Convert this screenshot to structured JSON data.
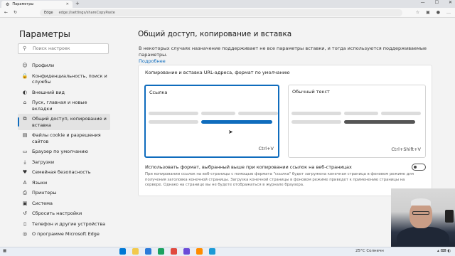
{
  "browser": {
    "tab_title": "Параметры",
    "address_prefix": "Edge",
    "address_url": "edge://settings/shareCopyPaste"
  },
  "sidebar": {
    "title": "Параметры",
    "search_placeholder": "Поиск настроек",
    "items": [
      {
        "label": "Профили",
        "icon": "person-icon"
      },
      {
        "label": "Конфиденциальность, поиск и службы",
        "icon": "lock-icon"
      },
      {
        "label": "Внешний вид",
        "icon": "appearance-icon"
      },
      {
        "label": "Пуск, главная и новые вкладки",
        "icon": "home-icon"
      },
      {
        "label": "Общий доступ, копирование и вставка",
        "icon": "share-icon",
        "active": true
      },
      {
        "label": "Файлы cookie и разрешения сайтов",
        "icon": "cookie-icon"
      },
      {
        "label": "Браузер по умолчанию",
        "icon": "browser-icon"
      },
      {
        "label": "Загрузки",
        "icon": "download-icon"
      },
      {
        "label": "Семейная безопасность",
        "icon": "family-icon"
      },
      {
        "label": "Языки",
        "icon": "language-icon"
      },
      {
        "label": "Принтеры",
        "icon": "printer-icon"
      },
      {
        "label": "Система",
        "icon": "system-icon"
      },
      {
        "label": "Сбросить настройки",
        "icon": "reset-icon"
      },
      {
        "label": "Телефон и другие устройства",
        "icon": "phone-icon"
      },
      {
        "label": "О программе Microsoft Edge",
        "icon": "edge-icon"
      }
    ]
  },
  "main": {
    "title": "Общий доступ, копирование и вставка",
    "description": "В некоторых случаях назначение поддерживает не все параметры вставки, и тогда используются поддерживаемые параметры.",
    "more_link": "Подробнее",
    "card": {
      "heading": "Копирование и вставка URL-адреса, формат по умолчанию",
      "option_link": {
        "label": "Ссылка",
        "shortcut": "Ctrl+V",
        "selected": true
      },
      "option_plain": {
        "label": "Обычный текст",
        "shortcut": "Ctrl+Shift+V",
        "selected": false
      },
      "toggle_label": "Использовать формат, выбранный выше при копировании ссылок на веб-страницах",
      "toggle_on": false,
      "toggle_description": "При копировании ссылок на веб-страницы с помощью формата \"ссылка\" будет загружена конечная страница в фоновом режиме для получения заголовка конечной страницы. Загрузка конечной страницы в фоновом режиме приведет к применению страницы на сервере. Однако на странице вы не будете отображаться в журнале браузера."
    }
  },
  "taskbar": {
    "weather": "25°C Солнечн",
    "colors": [
      "#0078d4",
      "#f2c94c",
      "#2b7bd9",
      "#1aa260",
      "#e04a3f",
      "#6b4bd8",
      "#ff8c00",
      "#1b9ad6"
    ]
  },
  "colors": {
    "accent": "#0f6cbd",
    "selected_bar": "#0f6cbd",
    "plain_bar": "#555555"
  }
}
